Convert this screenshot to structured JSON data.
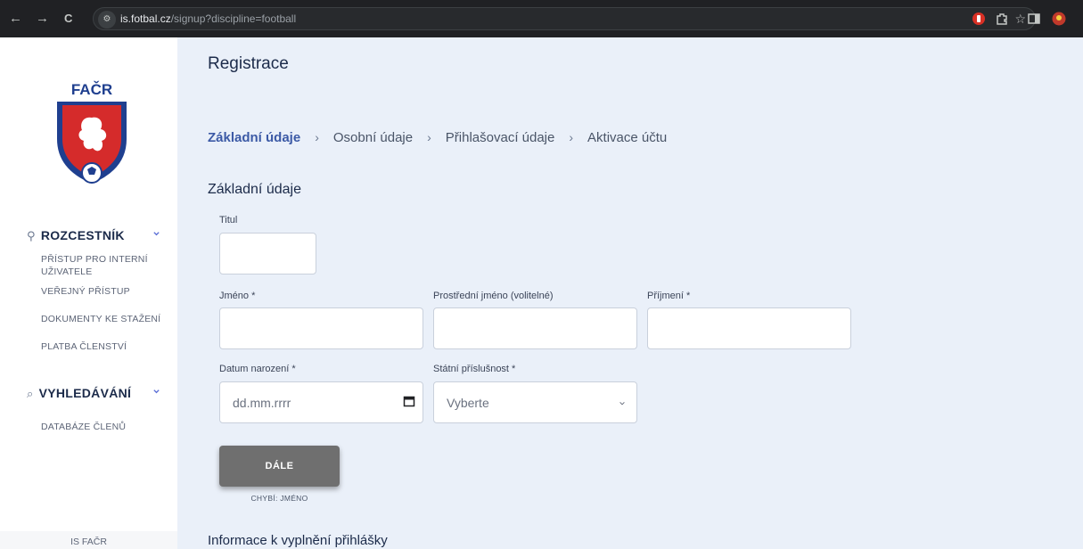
{
  "browser": {
    "back_icon": "←",
    "forward_icon": "→",
    "reload_icon": "C",
    "url_domain": "is.fotbal.cz",
    "url_path": "/signup?discipline=football",
    "star_icon": "☆"
  },
  "sidebar": {
    "logo_text": "FAČR",
    "sections": [
      {
        "icon": "person-icon",
        "label": "ROZCESTNÍK"
      },
      {
        "icon": "search-icon",
        "label": "VYHLEDÁVÁNÍ"
      }
    ],
    "links_rozcestnik": [
      "PŘÍSTUP PRO INTERNÍ UŽIVATELE",
      "VEŘEJNÝ PŘÍSTUP",
      "DOKUMENTY KE STAŽENÍ",
      "PLATBA ČLENSTVÍ"
    ],
    "links_vyhledavani": [
      "DATABÁZE ČLENŮ"
    ],
    "footer": "IS FAČR"
  },
  "main": {
    "title": "Registrace",
    "steps": [
      "Základní údaje",
      "Osobní údaje",
      "Přihlašovací údaje",
      "Aktivace účtu"
    ],
    "active_step": 0,
    "section_title": "Základní údaje",
    "fields": {
      "titul": {
        "label": "Titul",
        "value": ""
      },
      "jmeno": {
        "label": "Jméno *",
        "value": ""
      },
      "prostredni": {
        "label": "Prostřední jméno (volitelné)",
        "value": ""
      },
      "prijmeni": {
        "label": "Příjmení *",
        "value": ""
      },
      "datum": {
        "label": "Datum narození *",
        "placeholder": "dd.mm.rrrr"
      },
      "statni": {
        "label": "Státní příslušnost *",
        "selected": "Vyberte"
      }
    },
    "next_button": "DÁLE",
    "missing_note": "CHYBÍ: JMÉNO",
    "info_title": "Informace k vyplnění přihlášky"
  },
  "colors": {
    "accent": "#3c5aa6",
    "background": "#eaf0f9",
    "button": "#6f6f6f"
  }
}
